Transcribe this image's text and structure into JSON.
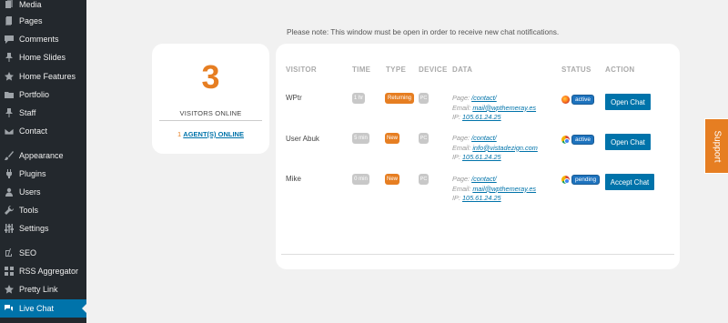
{
  "sidebar": {
    "items": [
      {
        "label": "Media",
        "icon": "media-icon"
      },
      {
        "label": "Pages",
        "icon": "pages-icon"
      },
      {
        "label": "Comments",
        "icon": "comments-icon"
      },
      {
        "label": "Home Slides",
        "icon": "pin-icon"
      },
      {
        "label": "Home Features",
        "icon": "star-icon"
      },
      {
        "label": "Portfolio",
        "icon": "folder-icon"
      },
      {
        "label": "Staff",
        "icon": "pin-icon"
      },
      {
        "label": "Contact",
        "icon": "envelope-icon"
      },
      {
        "label": "Appearance",
        "icon": "brush-icon"
      },
      {
        "label": "Plugins",
        "icon": "plug-icon"
      },
      {
        "label": "Users",
        "icon": "users-icon"
      },
      {
        "label": "Tools",
        "icon": "wrench-icon"
      },
      {
        "label": "Settings",
        "icon": "sliders-icon"
      },
      {
        "label": "SEO",
        "icon": "yoast-icon"
      },
      {
        "label": "RSS Aggregator",
        "icon": "grid-icon"
      },
      {
        "label": "Pretty Link",
        "icon": "star-icon"
      },
      {
        "label": "Live Chat",
        "icon": "chat-icon"
      }
    ]
  },
  "note": "Please note: This window must be open in order to receive new chat notifications.",
  "stats": {
    "count": "3",
    "visitors_label": "VISITORS ONLINE",
    "agents_count": "1",
    "agents_label": "AGENT(S) ONLINE"
  },
  "table": {
    "headers": {
      "visitor": "VISITOR",
      "time": "TIME",
      "type": "TYPE",
      "device": "DEVICE",
      "data": "DATA",
      "status": "STATUS",
      "action": "ACTION"
    },
    "page_label": "Page:",
    "email_label": "Email:",
    "ip_label": "IP:",
    "rows": [
      {
        "visitor": "WPtr",
        "time": "1 hr",
        "type": "Returning",
        "device": "PC",
        "page": "/contact/",
        "email": "mail@wpthemeray.es",
        "ip": "105.61.24.25",
        "browser": "firefox",
        "status": "active",
        "action": "Open Chat"
      },
      {
        "visitor": "User Abuk",
        "time": "5 min",
        "type": "New",
        "device": "PC",
        "page": "/contact/",
        "email": "info@vistadezign.com",
        "ip": "105.61.24.25",
        "browser": "chrome",
        "status": "active",
        "action": "Open Chat"
      },
      {
        "visitor": "Mike",
        "time": "0 min",
        "type": "New",
        "device": "PC",
        "page": "/contact/",
        "email": "mail@wpthemeray.es",
        "ip": "105.61.24.25",
        "browser": "chrome",
        "status": "pending",
        "action": "Accept Chat"
      }
    ]
  },
  "support_tab": "Support",
  "colors": {
    "accent": "#e67e22",
    "primary": "#0073aa",
    "sidebar": "#23282d"
  }
}
